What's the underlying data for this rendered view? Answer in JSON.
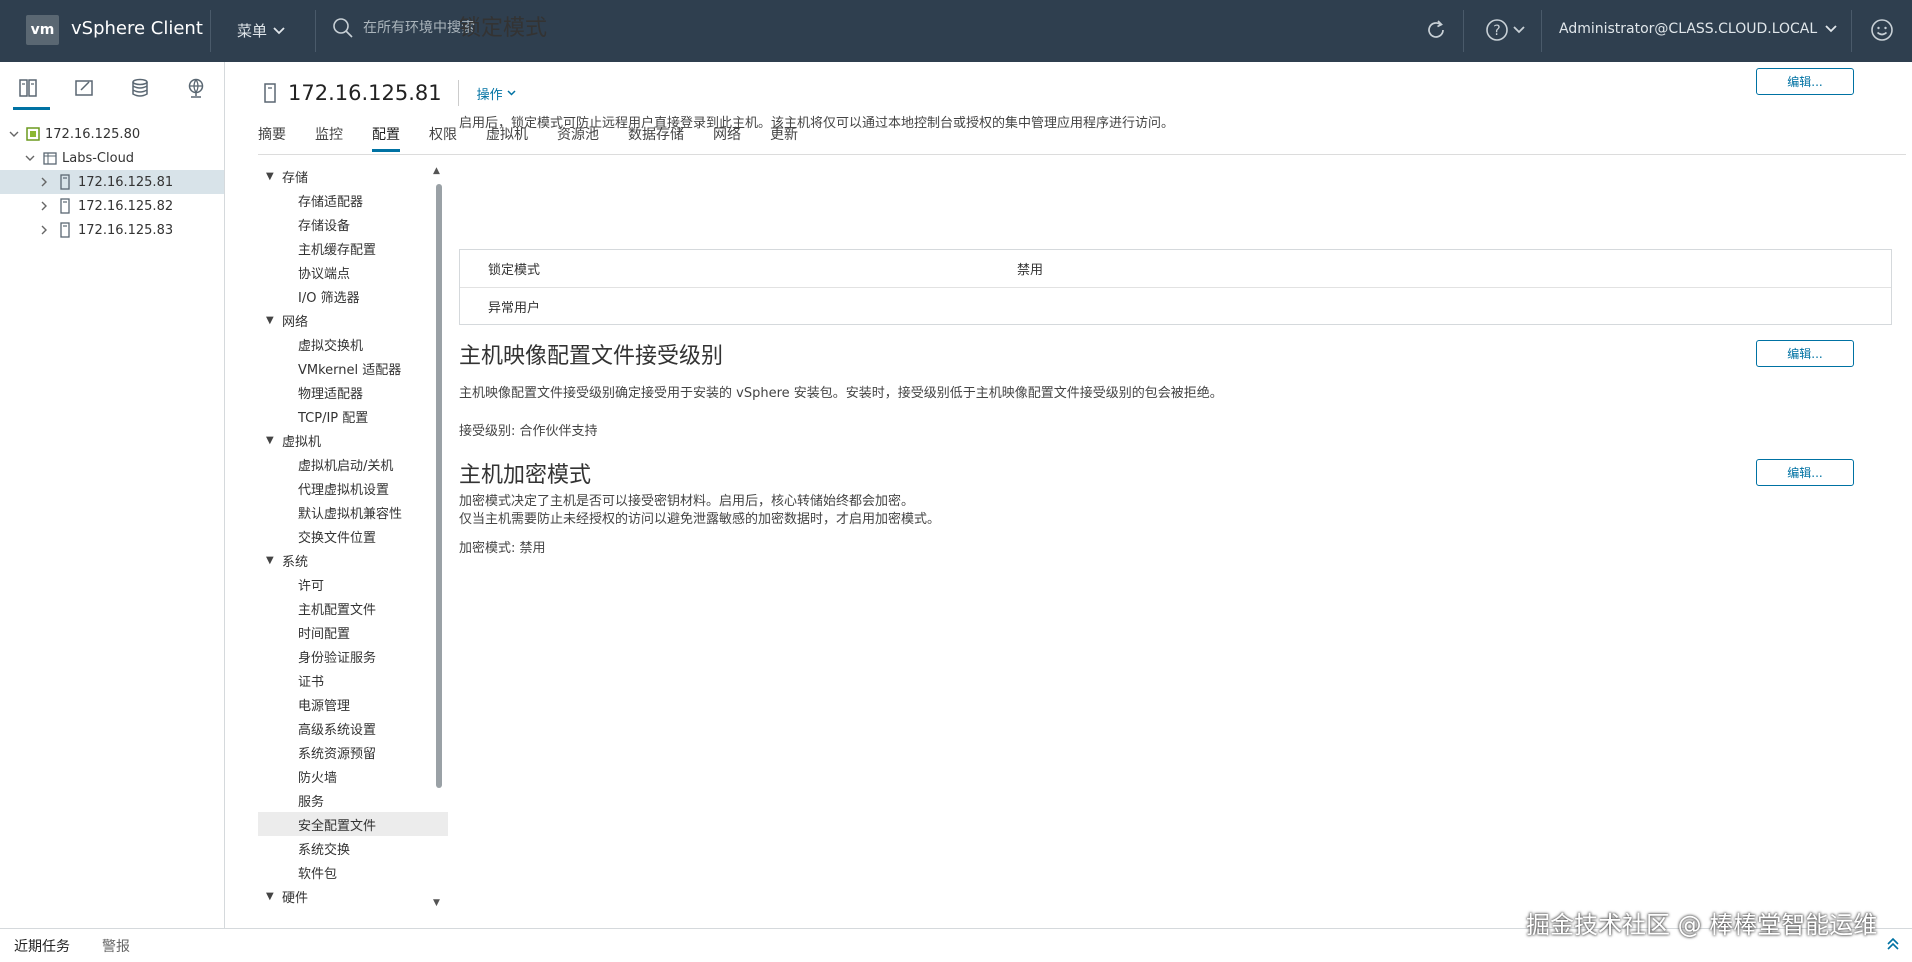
{
  "header": {
    "logo": "vm",
    "app_title": "vSphere Client",
    "menu_label": "菜单",
    "search_placeholder": "在所有环境中搜索",
    "user_label": "Administrator@CLASS.CLOUD.LOCAL"
  },
  "navigator": {
    "tabs": [
      {
        "icon": "hosts-clusters-icon"
      },
      {
        "icon": "vms-templates-icon"
      },
      {
        "icon": "storage-icon"
      },
      {
        "icon": "networking-icon"
      }
    ],
    "tree": [
      {
        "label": "172.16.125.80",
        "icon": "vcenter-icon",
        "level": 0,
        "expanded": true
      },
      {
        "label": "Labs-Cloud",
        "icon": "datacenter-icon",
        "level": 1,
        "expanded": true
      },
      {
        "label": "172.16.125.81",
        "icon": "host-icon",
        "level": 2,
        "selected": true
      },
      {
        "label": "172.16.125.82",
        "icon": "host-icon",
        "level": 2
      },
      {
        "label": "172.16.125.83",
        "icon": "host-icon",
        "level": 2
      }
    ]
  },
  "object": {
    "title": "172.16.125.81",
    "actions_label": "操作"
  },
  "tabs": [
    "摘要",
    "监控",
    "配置",
    "权限",
    "虚拟机",
    "资源池",
    "数据存储",
    "网络",
    "更新"
  ],
  "active_tab": "配置",
  "config_menu": [
    {
      "group": "存储",
      "items": [
        "存储适配器",
        "存储设备",
        "主机缓存配置",
        "协议端点",
        "I/O 筛选器"
      ]
    },
    {
      "group": "网络",
      "items": [
        "虚拟交换机",
        "VMkernel 适配器",
        "物理适配器",
        "TCP/IP 配置"
      ]
    },
    {
      "group": "虚拟机",
      "items": [
        "虚拟机启动/关机",
        "代理虚拟机设置",
        "默认虚拟机兼容性",
        "交换文件位置"
      ]
    },
    {
      "group": "系统",
      "items": [
        "许可",
        "主机配置文件",
        "时间配置",
        "身份验证服务",
        "证书",
        "电源管理",
        "高级系统设置",
        "系统资源预留",
        "防火墙",
        "服务",
        "安全配置文件",
        "系统交换",
        "软件包"
      ]
    },
    {
      "group": "硬件",
      "items": []
    }
  ],
  "selected_config_item": "安全配置文件",
  "lockdown": {
    "title": "锁定模式",
    "edit_label": "编辑...",
    "desc": "启用后，锁定模式可防止远程用户直接登录到此主机。该主机将仅可以通过本地控制台或授权的集中管理应用程序进行访问。",
    "rows": [
      {
        "key": "锁定模式",
        "value": "禁用"
      },
      {
        "key": "异常用户",
        "value": ""
      }
    ]
  },
  "acceptance": {
    "title": "主机映像配置文件接受级别",
    "edit_label": "编辑...",
    "desc": "主机映像配置文件接受级别确定接受用于安装的 vSphere 安装包。安装时，接受级别低于主机映像配置文件接受级别的包会被拒绝。",
    "level": "接受级别: 合作伙伴支持"
  },
  "encryption": {
    "title": "主机加密模式",
    "edit_label": "编辑...",
    "desc1": "加密模式决定了主机是否可以接受密钥材料。启用后，核心转储始终都会加密。",
    "desc2": "仅当主机需要防止未经授权的访问以避免泄露敏感的加密数据时，才启用加密模式。",
    "mode": "加密模式: 禁用"
  },
  "bottom": {
    "tabs": [
      "近期任务",
      "警报"
    ]
  },
  "watermark": "掘金技术社区 @ 棒棒堂智能运维",
  "colors": {
    "header_bg": "#2f3f4f",
    "accent": "#0072a3",
    "selected_bg": "#d8e3e9"
  }
}
